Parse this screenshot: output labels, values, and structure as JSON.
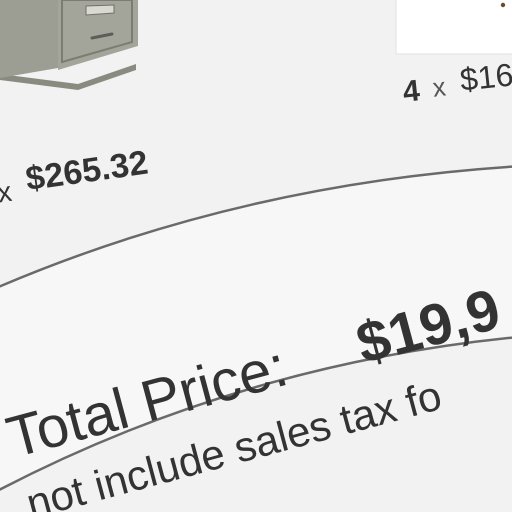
{
  "items": [
    {
      "name": "file-cabinet",
      "multiplier": "x",
      "price": "$265.32"
    },
    {
      "name": "second-item",
      "quantity": "4",
      "multiplier": "x",
      "price": "$16"
    }
  ],
  "summary": {
    "total_label": "Total Price:",
    "total_value": "$19,9",
    "tax_note": "not include sales tax fo"
  },
  "colors": {
    "background": "#f2f2f2",
    "text": "#333333",
    "banner_fill": "#f7f7f7",
    "banner_stroke": "#6a6a6a",
    "cabinet_body": "#9a9b8f",
    "cabinet_dark": "#7e7f74"
  }
}
